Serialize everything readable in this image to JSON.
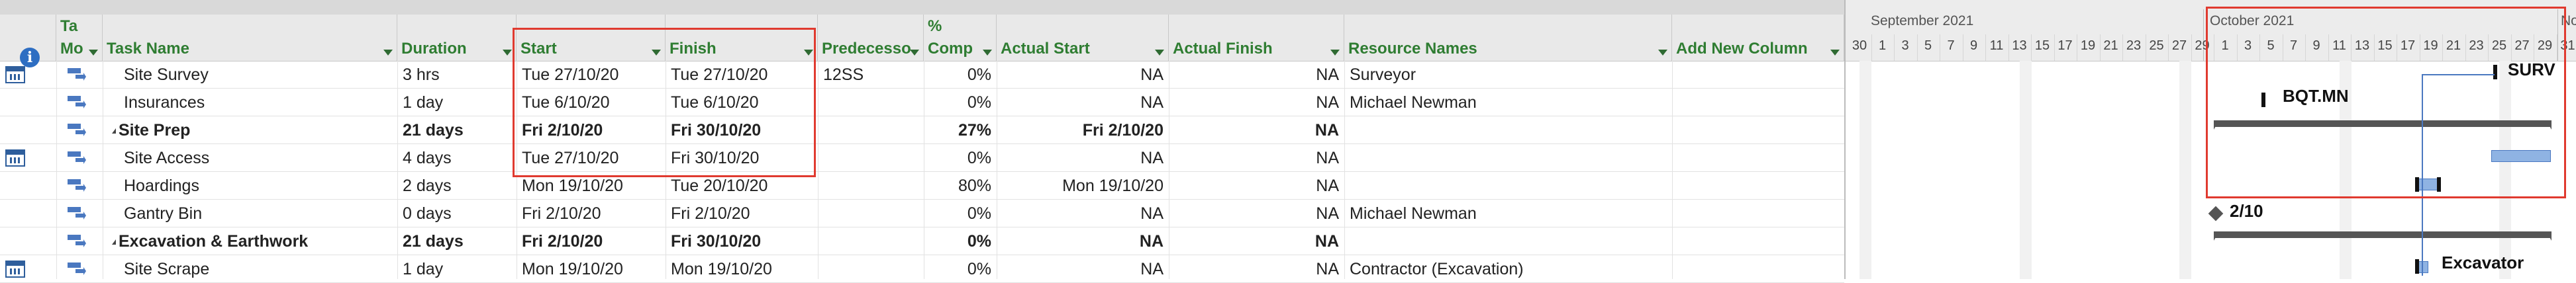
{
  "columns": {
    "task_mode": "Task Mode",
    "task_mode_short_top": "Ta",
    "task_mode_short_bottom": "Mo",
    "task_name": "Task Name",
    "duration": "Duration",
    "start": "Start",
    "finish": "Finish",
    "predecessors": "Predecesso",
    "pct_complete_top": "%",
    "pct_complete_bottom": "Comp",
    "actual_start": "Actual Start",
    "actual_finish": "Actual Finish",
    "resource_names": "Resource Names",
    "add_new_column": "Add New Column"
  },
  "tasks": [
    {
      "name": "Site Survey",
      "duration": "3 hrs",
      "start": "Tue 27/10/20",
      "finish": "Tue 27/10/20",
      "pred": "12SS",
      "pct": "0%",
      "astart": "NA",
      "afinish": "NA",
      "resource": "Surveyor",
      "summary": false,
      "calendar_icon": true
    },
    {
      "name": "Insurances",
      "duration": "1 day",
      "start": "Tue 6/10/20",
      "finish": "Tue 6/10/20",
      "pred": "",
      "pct": "0%",
      "astart": "NA",
      "afinish": "NA",
      "resource": "Michael Newman",
      "summary": false,
      "calendar_icon": false
    },
    {
      "name": "Site Prep",
      "duration": "21 days",
      "start": "Fri 2/10/20",
      "finish": "Fri 30/10/20",
      "pred": "",
      "pct": "27%",
      "astart": "Fri 2/10/20",
      "afinish": "NA",
      "resource": "",
      "summary": true,
      "calendar_icon": false
    },
    {
      "name": "Site Access",
      "duration": "4 days",
      "start": "Tue 27/10/20",
      "finish": "Fri 30/10/20",
      "pred": "",
      "pct": "0%",
      "astart": "NA",
      "afinish": "NA",
      "resource": "",
      "summary": false,
      "calendar_icon": true
    },
    {
      "name": "Hoardings",
      "duration": "2 days",
      "start": "Mon 19/10/20",
      "finish": "Tue 20/10/20",
      "pred": "",
      "pct": "80%",
      "astart": "Mon 19/10/20",
      "afinish": "NA",
      "resource": "",
      "summary": false,
      "calendar_icon": false
    },
    {
      "name": "Gantry Bin",
      "duration": "0 days",
      "start": "Fri 2/10/20",
      "finish": "Fri 2/10/20",
      "pred": "",
      "pct": "0%",
      "astart": "NA",
      "afinish": "NA",
      "resource": "Michael Newman",
      "summary": false,
      "calendar_icon": false
    },
    {
      "name": "Excavation & Earthwork",
      "duration": "21 days",
      "start": "Fri 2/10/20",
      "finish": "Fri 30/10/20",
      "pred": "",
      "pct": "0%",
      "astart": "NA",
      "afinish": "NA",
      "resource": "",
      "summary": true,
      "calendar_icon": false
    },
    {
      "name": "Site Scrape",
      "duration": "1 day",
      "start": "Mon 19/10/20",
      "finish": "Mon 19/10/20",
      "pred": "",
      "pct": "0%",
      "astart": "NA",
      "afinish": "NA",
      "resource": "Contractor (Excavation)",
      "summary": false,
      "calendar_icon": true
    }
  ],
  "timescale": {
    "month_sep": "September 2021",
    "month_oct": "October 2021",
    "month_nov": "Nov",
    "days": [
      "30",
      "1",
      "3",
      "5",
      "7",
      "9",
      "11",
      "13",
      "15",
      "17",
      "19",
      "21",
      "23",
      "25",
      "27",
      "29",
      "1",
      "3",
      "5",
      "7",
      "9",
      "11",
      "13",
      "15",
      "17",
      "19",
      "21",
      "23",
      "25",
      "27",
      "29",
      "31"
    ]
  },
  "gantt_labels": {
    "site_survey": "SURV",
    "insurances": "BQT.MN",
    "gantry_bin": "2/10",
    "site_scrape": "Excavator"
  },
  "colors": {
    "header_text": "#2f7d32",
    "task_bar": "#8fb3e3",
    "summary_bar": "#555555",
    "highlight_box": "#e03a2f"
  }
}
